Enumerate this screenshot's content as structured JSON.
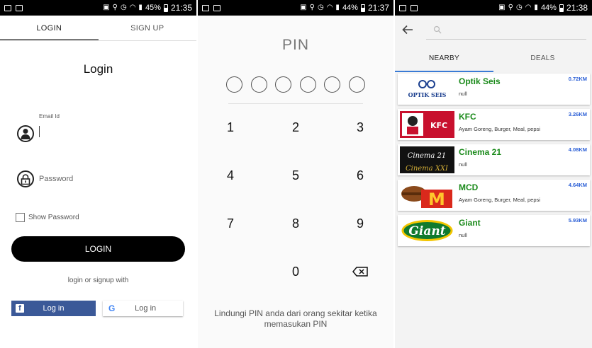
{
  "login_screen": {
    "status": {
      "battery": "45%",
      "time": "21:35"
    },
    "tabs": [
      {
        "label": "LOGIN"
      },
      {
        "label": "SIGN UP"
      }
    ],
    "title": "Login",
    "email_label": "Email Id",
    "password_placeholder": "Password",
    "show_password": "Show Password",
    "login_button": "LOGIN",
    "or_text": "login or signup with",
    "facebook_button": "Log in",
    "google_button": "Log in"
  },
  "pin_screen": {
    "status": {
      "battery": "44%",
      "time": "21:37"
    },
    "title": "PIN",
    "keys": [
      "1",
      "2",
      "3",
      "4",
      "5",
      "6",
      "7",
      "8",
      "9",
      "0"
    ],
    "message": "Lindungi PIN anda dari orang sekitar ketika memasukan PIN"
  },
  "nearby_screen": {
    "status": {
      "battery": "44%",
      "time": "21:38"
    },
    "tabs": [
      {
        "label": "NEARBY"
      },
      {
        "label": "DEALS"
      }
    ],
    "items": [
      {
        "name": "Optik Seis",
        "desc": "null",
        "dist": "0.72KM",
        "logo_text": "OPTIK SEIS"
      },
      {
        "name": "KFC",
        "desc": "Ayam Goreng, Burger, Meal, pepsi",
        "dist": "3.26KM",
        "logo_text": "KFC"
      },
      {
        "name": "Cinema 21",
        "desc": "null",
        "dist": "4.08KM",
        "logo_text": "Cinema 21"
      },
      {
        "name": "MCD",
        "desc": "Ayam Goreng, Burger, Meal, pepsi",
        "dist": "4.64KM",
        "logo_text": "M"
      },
      {
        "name": "Giant",
        "desc": "null",
        "dist": "5.93KM",
        "logo_text": "Giant"
      }
    ]
  },
  "colors": {
    "accent_tab": "#3a7bd5",
    "merchant_name": "#1a8a1a",
    "distance": "#2b5fd6",
    "facebook": "#3b5998",
    "login_button": "#000000"
  }
}
